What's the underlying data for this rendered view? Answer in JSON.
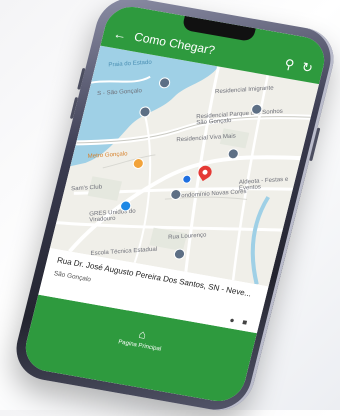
{
  "appbar": {
    "title": "Como Chegar?",
    "back_icon": "arrow-left-icon",
    "search_icon": "search-icon",
    "refresh_icon": "refresh-icon"
  },
  "map": {
    "labels": [
      "Praia do Estado",
      "Residencial Imigrante",
      "S - São Gonçalo",
      "Residencial Parque dos Sonhos São Gonçalo",
      "Residencial Viva Mais",
      "Metro Gonçalo",
      "Aldeota - Festas e Eventos",
      "Condomínio Novas Cores",
      "Sam's Club",
      "GRES Unidos do Viradouro",
      "Rua Lourenço",
      "Escola Técnica Estadual"
    ]
  },
  "location": {
    "address": "Rua Dr. José Augusto Pereira Dos Santos, SN - Neve...",
    "city": "São Gonçalo"
  },
  "bottom_nav": {
    "home_label": "Pagina Principal"
  },
  "colors": {
    "primary_green": "#2e9a3e",
    "water": "#9fd0e6",
    "pin": "#e53935"
  }
}
